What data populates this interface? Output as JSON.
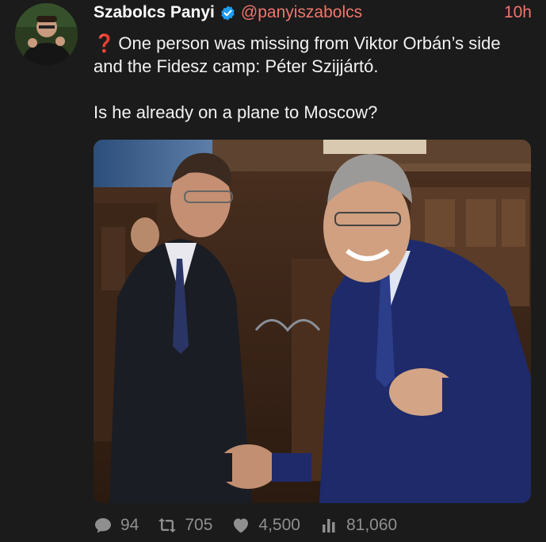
{
  "tweet": {
    "author": {
      "display_name": "Szabolcs Panyi",
      "handle": "@panyiszabolcs",
      "verified_icon": "verified-badge-icon"
    },
    "time": "10h",
    "emoji": "❓",
    "line1": "One person was missing from Viktor Orbán’s side and the Fidesz camp: Péter Szijjártó.",
    "line2": "Is he already on a plane to Moscow?",
    "stats": {
      "replies": "94",
      "retweets": "705",
      "likes": "4,500",
      "views": "81,060"
    }
  },
  "colors": {
    "background": "#1b1b1b",
    "handle": "#f0756c",
    "verified": "#1d9bf0",
    "muted": "#8f8f8f"
  }
}
